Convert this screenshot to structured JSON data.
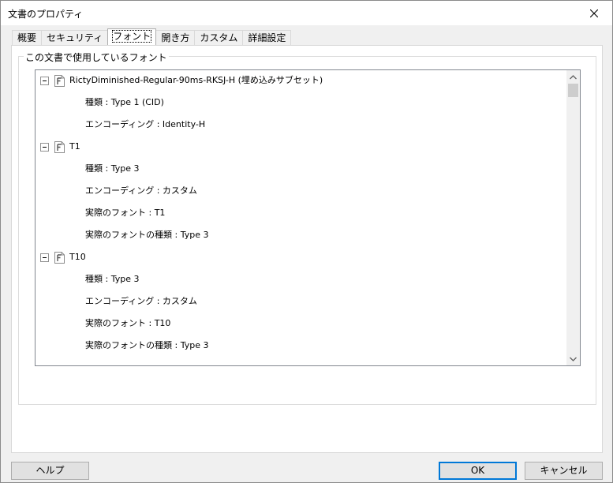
{
  "window": {
    "title": "文書のプロパティ"
  },
  "tabs": [
    {
      "label": "概要",
      "active": false
    },
    {
      "label": "セキュリティ",
      "active": false
    },
    {
      "label": "フォント",
      "active": true
    },
    {
      "label": "開き方",
      "active": false
    },
    {
      "label": "カスタム",
      "active": false
    },
    {
      "label": "詳細設定",
      "active": false
    }
  ],
  "fonts_group": {
    "label": "この文書で使用しているフォント",
    "fonts": [
      {
        "name": "RictyDiminished-Regular-90ms-RKSJ-H (埋め込みサブセット)",
        "properties": [
          "種類 : Type 1 (CID)",
          "エンコーディング : Identity-H"
        ]
      },
      {
        "name": "T1",
        "properties": [
          "種類 : Type 3",
          "エンコーディング : カスタム",
          "実際のフォント : T1",
          "実際のフォントの種類 : Type 3"
        ]
      },
      {
        "name": "T10",
        "properties": [
          "種類 : Type 3",
          "エンコーディング : カスタム",
          "実際のフォント : T10",
          "実際のフォントの種類 : Type 3"
        ]
      }
    ]
  },
  "buttons": {
    "help": "ヘルプ",
    "ok": "OK",
    "cancel": "キャンセル"
  },
  "icons": {
    "close": "close-icon",
    "collapse": "collapse-icon",
    "font": "font-file-icon",
    "scroll_up": "chevron-up-icon",
    "scroll_down": "chevron-down-icon"
  }
}
